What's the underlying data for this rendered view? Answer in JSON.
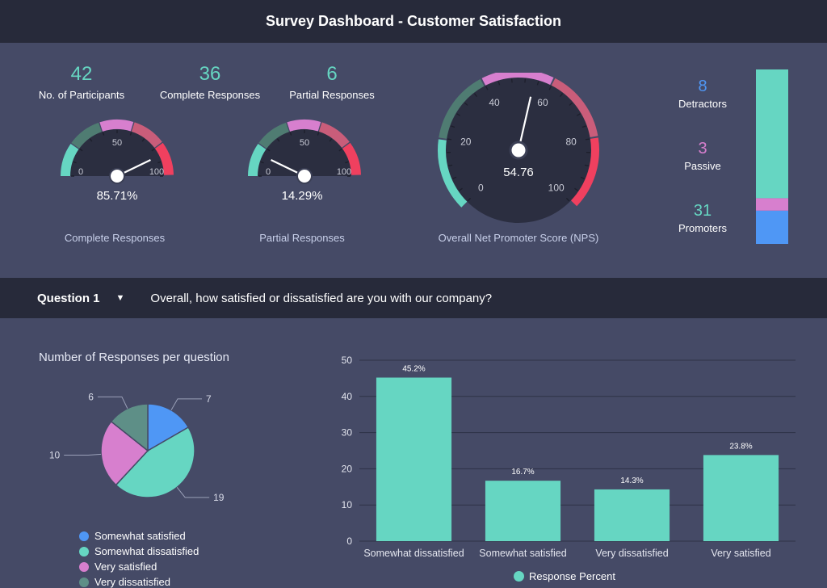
{
  "header": {
    "title": "Survey Dashboard - Customer Satisfaction"
  },
  "kpis": [
    {
      "value": "42",
      "label": "No. of Participants"
    },
    {
      "value": "36",
      "label": "Complete Responses"
    },
    {
      "value": "6",
      "label": "Partial Responses"
    }
  ],
  "gauges": {
    "complete": {
      "caption": "Complete Responses",
      "value_text": "85.71%",
      "fraction": 0.8571,
      "ticks": {
        "min": "0",
        "mid": "50",
        "max": "100"
      }
    },
    "partial": {
      "caption": "Partial Responses",
      "value_text": "14.29%",
      "fraction": 0.1429,
      "ticks": {
        "min": "0",
        "mid": "50",
        "max": "100"
      }
    },
    "nps": {
      "caption": "Overall Net Promoter Score (NPS)",
      "value_text": "54.76",
      "value": 54.76,
      "ticks": [
        "0",
        "20",
        "40",
        "60",
        "80",
        "100"
      ]
    }
  },
  "nps_breakdown": {
    "detractors": {
      "value": "8",
      "label": "Detractors"
    },
    "passive": {
      "value": "3",
      "label": "Passive"
    },
    "promoters": {
      "value": "31",
      "label": "Promoters"
    }
  },
  "question": {
    "selector_label": "Question 1",
    "text": "Overall, how satisfied or dissatisfied are you with our company?"
  },
  "colors": {
    "teal": "#66d6c2",
    "blue": "#4f97f5",
    "pink": "#d77fce",
    "gray_green": "#5e8f87",
    "red": "#f0405f",
    "rose": "#c95d7a",
    "dark_green": "#4f7c72"
  },
  "chart_data": [
    {
      "type": "pie",
      "title": "Number of Responses per question",
      "slices": [
        {
          "name": "Somewhat satisfied",
          "value": 7,
          "label": "7",
          "color": "#4f97f5"
        },
        {
          "name": "Somewhat dissatisfied",
          "value": 19,
          "label": "19",
          "color": "#66d6c2"
        },
        {
          "name": "Very satisfied",
          "value": 10,
          "label": "10",
          "color": "#d77fce"
        },
        {
          "name": "Very dissatisfied",
          "value": 6,
          "label": "6",
          "color": "#5e8f87"
        }
      ]
    },
    {
      "type": "bar",
      "categories": [
        "Somewhat dissatisfied",
        "Somewhat satisfied",
        "Very dissatisfied",
        "Very satisfied"
      ],
      "series": [
        {
          "name": "Response Percent",
          "values": [
            45.2,
            16.7,
            14.3,
            23.8
          ],
          "labels": [
            "45.2%",
            "16.7%",
            "14.3%",
            "23.8%"
          ]
        }
      ],
      "ylim": [
        0,
        50
      ],
      "yticks": [
        "0",
        "10",
        "20",
        "30",
        "40",
        "50"
      ],
      "grid": true,
      "legend": "bottom"
    }
  ]
}
